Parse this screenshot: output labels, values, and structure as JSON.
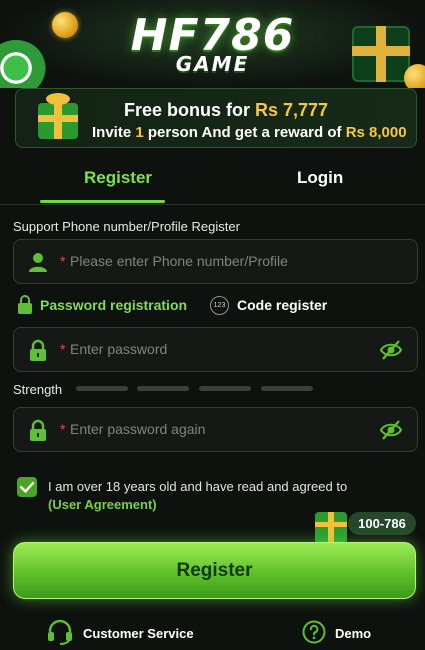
{
  "header": {
    "logo_main": "HF786",
    "logo_sub": "GAME"
  },
  "bonus": {
    "line1_prefix": "Free bonus for ",
    "line1_amount": "Rs 7,777",
    "line2_prefix": "Invite ",
    "line2_count": "1",
    "line2_middle": " person And get a reward of ",
    "line2_amount": "Rs 8,000"
  },
  "tabs": {
    "register": "Register",
    "login": "Login",
    "active": "register"
  },
  "form": {
    "phone_label": "Support Phone number/Profile Register",
    "required_mark": "*",
    "phone_placeholder": "Please enter Phone number/Profile",
    "password_registration": "Password registration",
    "code_badge": "123",
    "code_register": "Code register",
    "password_placeholder": "Enter password",
    "strength_label": "Strength",
    "strength_level": 0,
    "password_again_placeholder": "Enter password again",
    "agreement_text": "I am over 18 years old and have read and agreed to",
    "agreement_link": "(User Agreement)",
    "agreement_checked": true
  },
  "promo": {
    "code": "100-786"
  },
  "buttons": {
    "register": "Register"
  },
  "footer": {
    "customer_service": "Customer Service",
    "demo": "Demo"
  },
  "colors": {
    "accent": "#74d640",
    "gold": "#f6c645",
    "background": "#0e120f",
    "required": "#e14b4b"
  },
  "icons": {
    "user": "user-icon",
    "lock": "lock-icon",
    "eye_off": "eye-off-icon",
    "headset": "headset-icon",
    "help": "question-icon",
    "checkbox": "check-icon"
  }
}
